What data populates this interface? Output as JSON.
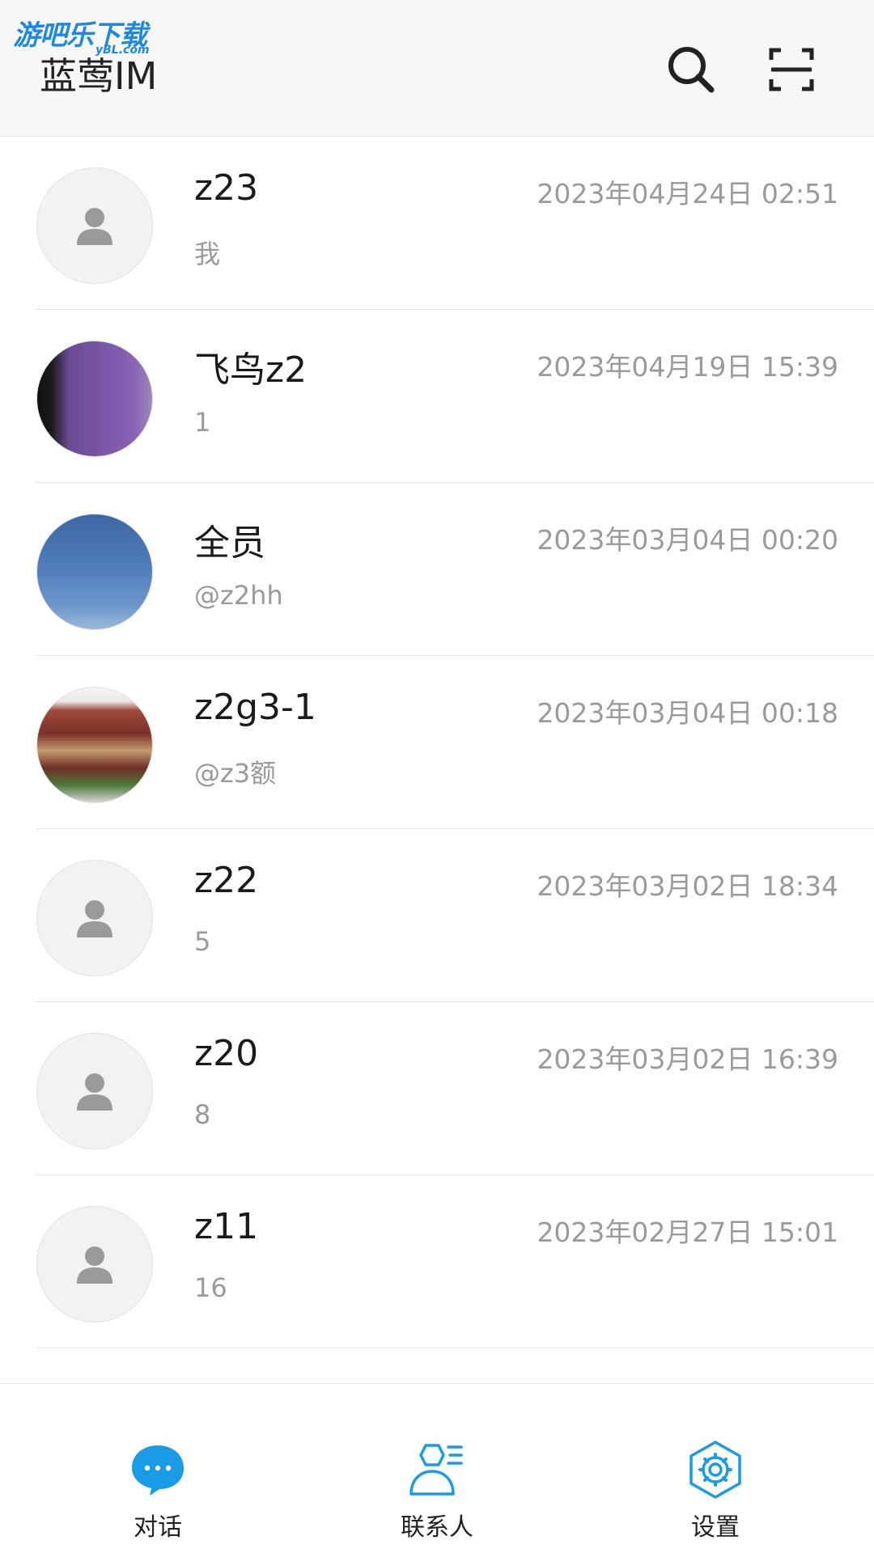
{
  "watermark": {
    "text": "游吧乐下载",
    "sub": "yBL.com"
  },
  "header": {
    "title": "蓝莺IM",
    "search_icon": "search-icon",
    "scan_icon": "scan-icon"
  },
  "conversations": [
    {
      "name": "z23",
      "time": "2023年04月24日 02:51",
      "message": "我",
      "avatar": "default-user"
    },
    {
      "name": "飞鸟z2",
      "time": "2023年04月19日 15:39",
      "message": "1",
      "avatar": "photo-purple"
    },
    {
      "name": "全员",
      "time": "2023年03月04日 00:20",
      "message": "@z2hh",
      "avatar": "photo-sky"
    },
    {
      "name": "z2g3-1",
      "time": "2023年03月04日 00:18",
      "message": "@z3额",
      "avatar": "photo-temple"
    },
    {
      "name": "z22",
      "time": "2023年03月02日 18:34",
      "message": "5",
      "avatar": "default-user"
    },
    {
      "name": "z20",
      "time": "2023年03月02日 16:39",
      "message": "8",
      "avatar": "default-user"
    },
    {
      "name": "z11",
      "time": "2023年02月27日 15:01",
      "message": "16",
      "avatar": "default-user"
    }
  ],
  "bottom_nav": {
    "chat": {
      "label": "对话",
      "icon": "chat-bubble-icon",
      "active": true
    },
    "contacts": {
      "label": "联系人",
      "icon": "contacts-icon",
      "active": false
    },
    "settings": {
      "label": "设置",
      "icon": "settings-gear-icon",
      "active": false
    }
  },
  "colors": {
    "accent": "#1a9be6",
    "header_bg": "#f7f7f7",
    "text_primary": "#1a1a1a",
    "text_secondary": "#9a9a9a"
  }
}
